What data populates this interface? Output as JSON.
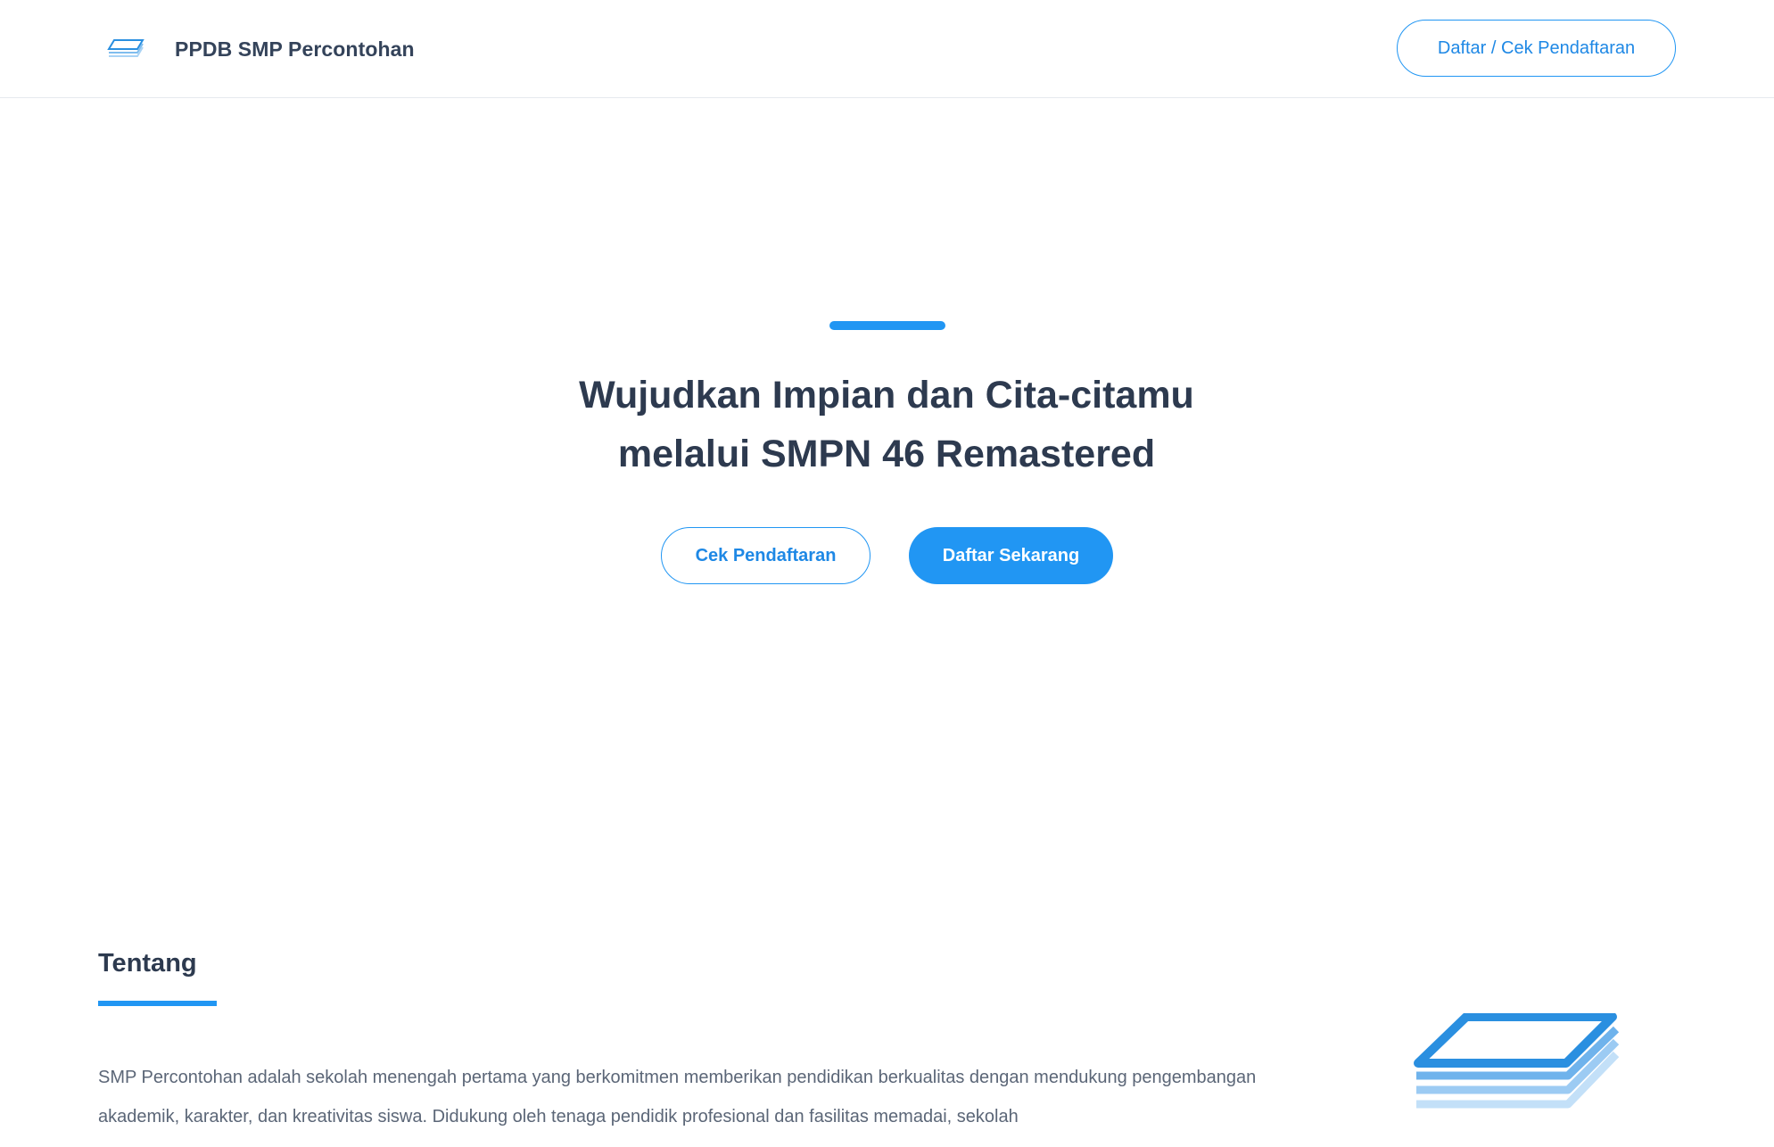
{
  "navbar": {
    "brand_icon": "stacked-layers-icon",
    "brand_name": "PPDB SMP Percontohan",
    "register_check_label": "Daftar / Cek Pendaftaran"
  },
  "hero": {
    "title_line1": "Wujudkan Impian dan Cita-citamu",
    "title_line2": "melalui SMPN 46 Remastered",
    "check_button_label": "Cek Pendaftaran",
    "register_button_label": "Daftar Sekarang"
  },
  "about": {
    "title": "Tentang",
    "description": "SMP Percontohan adalah sekolah menengah pertama yang berkomitmen memberikan pendidikan berkualitas dengan mendukung pengembangan akademik, karakter, dan kreativitas siswa. Didukung oleh tenaga pendidik profesional dan fasilitas memadai, sekolah",
    "illustration_icon": "stacked-layers-icon"
  },
  "colors": {
    "accent": "#2196f3",
    "text_dark": "#2d3a4f",
    "text_muted": "#5b6677"
  }
}
